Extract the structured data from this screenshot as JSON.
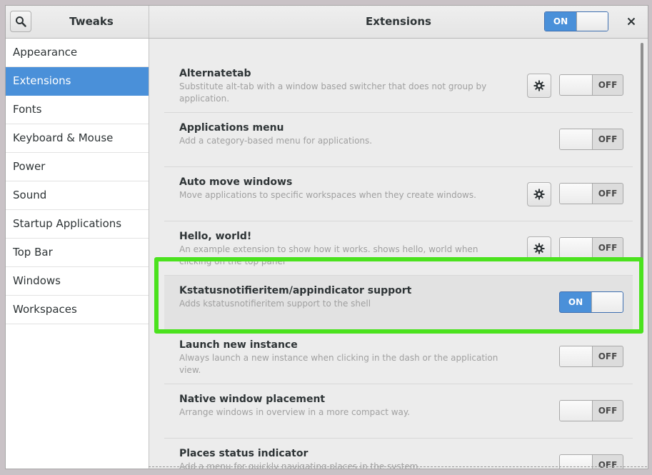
{
  "header": {
    "app_title": "Tweaks",
    "page_title": "Extensions",
    "master_switch_label": "ON"
  },
  "sidebar": {
    "items": [
      {
        "label": "Appearance"
      },
      {
        "label": "Extensions",
        "selected": true
      },
      {
        "label": "Fonts"
      },
      {
        "label": "Keyboard & Mouse"
      },
      {
        "label": "Power"
      },
      {
        "label": "Sound"
      },
      {
        "label": "Startup Applications"
      },
      {
        "label": "Top Bar"
      },
      {
        "label": "Windows"
      },
      {
        "label": "Workspaces"
      }
    ]
  },
  "extensions": [
    {
      "name": "Alternatetab",
      "description": "Substitute alt-tab with a window based switcher that does not group by application.",
      "has_settings": true,
      "state": "OFF"
    },
    {
      "name": "Applications menu",
      "description": "Add a category-based menu for applications.",
      "has_settings": false,
      "state": "OFF"
    },
    {
      "name": "Auto move windows",
      "description": "Move applications to specific workspaces when they create windows.",
      "has_settings": true,
      "state": "OFF"
    },
    {
      "name": "Hello, world!",
      "description": "An example extension to show how it works. shows hello, world when clicking on the top panel",
      "has_settings": true,
      "state": "OFF"
    },
    {
      "name": "Kstatusnotifieritem/appindicator support",
      "description": "Adds kstatusnotifieritem support to the shell",
      "has_settings": false,
      "state": "ON"
    },
    {
      "name": "Launch new instance",
      "description": "Always launch a new instance when clicking in the dash or the application view.",
      "has_settings": false,
      "state": "OFF"
    },
    {
      "name": "Native window placement",
      "description": "Arrange windows in overview in a more compact way.",
      "has_settings": false,
      "state": "OFF"
    },
    {
      "name": "Places status indicator",
      "description": "Add a menu for quickly navigating places in the system.",
      "has_settings": false,
      "state": "OFF"
    }
  ],
  "colors": {
    "accent": "#4a90d9",
    "highlight_box": "#4be21e"
  },
  "icons": {
    "search": "search-icon",
    "close": "close-icon",
    "settings": "gear-icon"
  }
}
